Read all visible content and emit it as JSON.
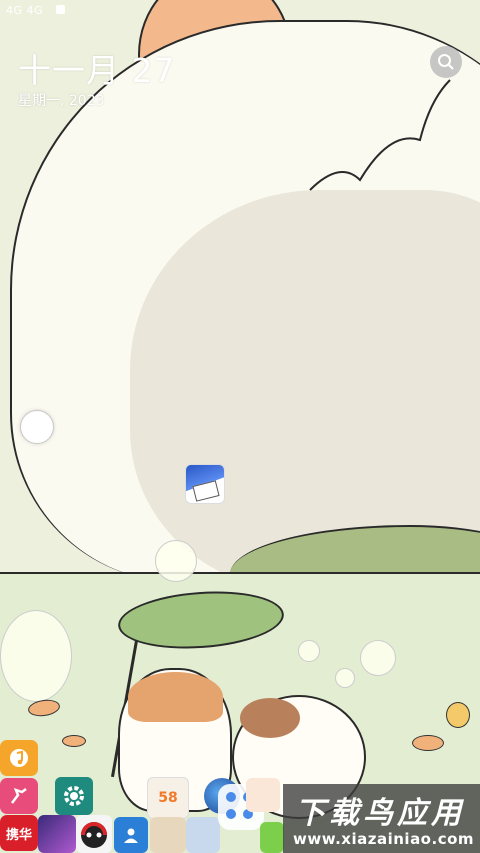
{
  "status_bar": {
    "text": "4G 4G"
  },
  "clock_widget": {
    "date": "十一月 27",
    "weekday_year": "星期一, 2023"
  },
  "icons": {
    "search": "search-icon",
    "settings": "gear-icon",
    "music": "music-note-icon",
    "contacts": "contacts-icon"
  },
  "left_apps": [
    {
      "name": "music-app",
      "label": "",
      "color": "#f39a2a"
    },
    {
      "name": "sports-app",
      "label": "",
      "color": "#e84c7a"
    },
    {
      "name": "xinhua-app",
      "label": "携华",
      "color": "#d9202a"
    },
    {
      "name": "purple-app",
      "label": "",
      "color": "#7b3ac8"
    }
  ],
  "dock_labels": {
    "app_58": "58"
  },
  "watermark": {
    "title": "下载鸟应用",
    "url": "www.xiazainiao.com"
  },
  "colors": {
    "sun": "#f3b98c",
    "hill": "#a8bc84",
    "leaf": "#9fc27e",
    "watermark_bg": "#3c3c3c"
  }
}
